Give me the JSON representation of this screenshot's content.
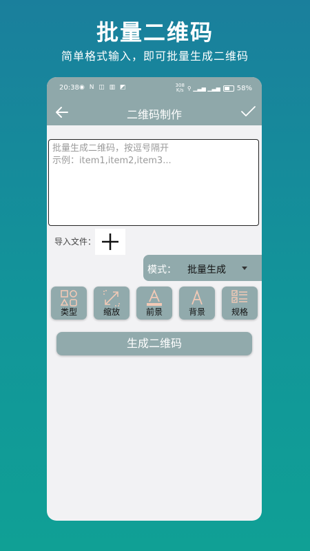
{
  "promo": {
    "title": "批量二维码",
    "subtitle": "简单格式输入，即可批量生成二维码"
  },
  "status_bar": {
    "time": "20:38",
    "icons": "◉ N ◫ ▥ ◩",
    "speed_top": "308",
    "speed_bottom": "K/s",
    "signal": "⚲ ▁▃▅ ▁▃▅",
    "battery": "58%"
  },
  "app_bar": {
    "title": "二维码制作"
  },
  "input": {
    "placeholder": "批量生成二维码，按逗号隔开\n示例：item1,item2,item3..."
  },
  "import": {
    "label": "导入文件："
  },
  "mode": {
    "label": "模式：",
    "value": "批量生成"
  },
  "tools": [
    {
      "label": "类型",
      "icon": "shapes-icon"
    },
    {
      "label": "缩放",
      "icon": "resize-icon"
    },
    {
      "label": "前景",
      "icon": "foreground-icon"
    },
    {
      "label": "背景",
      "icon": "background-icon"
    },
    {
      "label": "规格",
      "icon": "spec-list-icon"
    }
  ],
  "actions": {
    "generate": "生成二维码"
  },
  "colors": {
    "accent": "#91aaac",
    "icon_peach": "#f2c9b6",
    "bg_top": "#1a7f9c",
    "bg_bottom": "#10a095"
  }
}
